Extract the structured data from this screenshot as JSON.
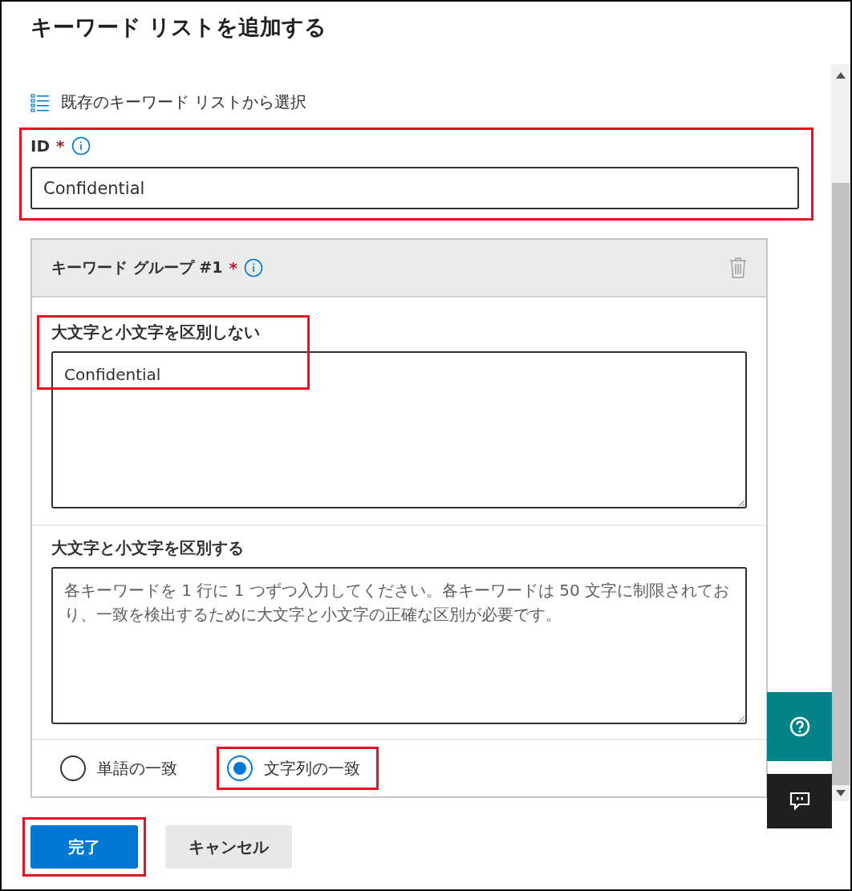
{
  "title": "キーワード リストを追加する",
  "existing_list_link": {
    "label": "既存のキーワード リストから選択"
  },
  "id_field": {
    "label": "ID",
    "required_mark": "*",
    "value": "Confidential",
    "highlighted": true
  },
  "keyword_group": {
    "title": "キーワード グループ #1",
    "required_mark": "*",
    "case_insensitive": {
      "label": "大文字と小文字を区別しない",
      "value": "Confidential",
      "highlighted": true
    },
    "case_sensitive": {
      "label": "大文字と小文字を区別する",
      "placeholder": "各キーワードを 1 行に 1 つずつ入力してください。各キーワードは 50 文字に制限されており、一致を検出するために大文字と小文字の正確な区別が必要です。"
    },
    "match_options": [
      {
        "label": "単語の一致",
        "selected": false,
        "highlighted": false
      },
      {
        "label": "文字列の一致",
        "selected": true,
        "highlighted": true
      }
    ]
  },
  "buttons": [
    {
      "label": "完了",
      "kind": "primary",
      "highlighted": true
    },
    {
      "label": "キャンセル",
      "kind": "secondary",
      "highlighted": false
    }
  ]
}
